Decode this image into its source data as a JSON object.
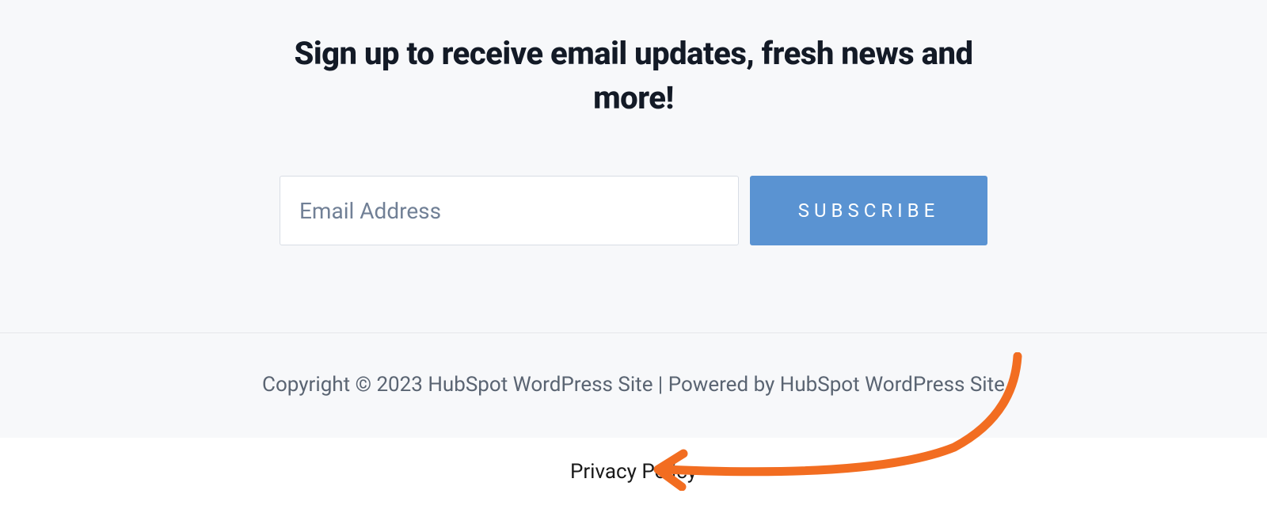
{
  "signup": {
    "heading": "Sign up to receive email updates, fresh news and more!",
    "email_placeholder": "Email Address",
    "subscribe_label": "SUBSCRIBE"
  },
  "footer": {
    "copyright": "Copyright © 2023 HubSpot WordPress Site | Powered by HubSpot WordPress Site",
    "privacy_link": "Privacy Policy"
  },
  "colors": {
    "accent": "#5a93d2",
    "annotation": "#f26d21"
  }
}
